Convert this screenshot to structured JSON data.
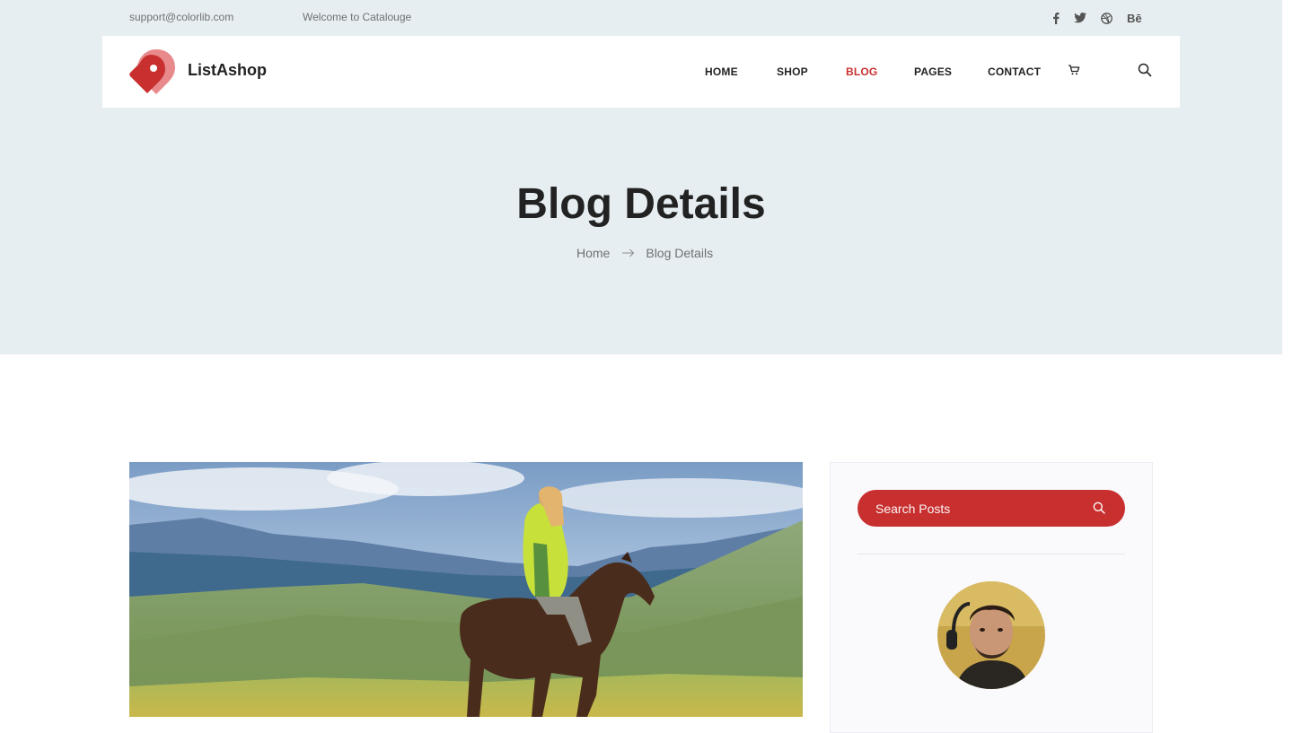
{
  "topbar": {
    "email": "support@colorlib.com",
    "welcome": "Welcome to Catalouge",
    "socials": [
      {
        "icon": "facebook-icon"
      },
      {
        "icon": "twitter-icon"
      },
      {
        "icon": "dribbble-icon"
      },
      {
        "icon": "behance-icon",
        "label": "Bē"
      }
    ]
  },
  "brand": {
    "name": "ListAshop",
    "accent": "#c83030",
    "logo_light": "#e8898b"
  },
  "nav": {
    "items": [
      {
        "label": "HOME"
      },
      {
        "label": "SHOP"
      },
      {
        "label": "BLOG",
        "active": true
      },
      {
        "label": "PAGES"
      },
      {
        "label": "CONTACT"
      }
    ],
    "cart_icon": "cart-icon",
    "search_icon": "search-icon"
  },
  "hero": {
    "title": "Blog Details",
    "background": "#e7eef1",
    "breadcrumb": {
      "home": "Home",
      "current": "Blog Details",
      "separator_icon": "arrow-right-icon"
    }
  },
  "sidebar": {
    "search": {
      "placeholder": "Search Posts",
      "icon": "search-icon"
    }
  }
}
